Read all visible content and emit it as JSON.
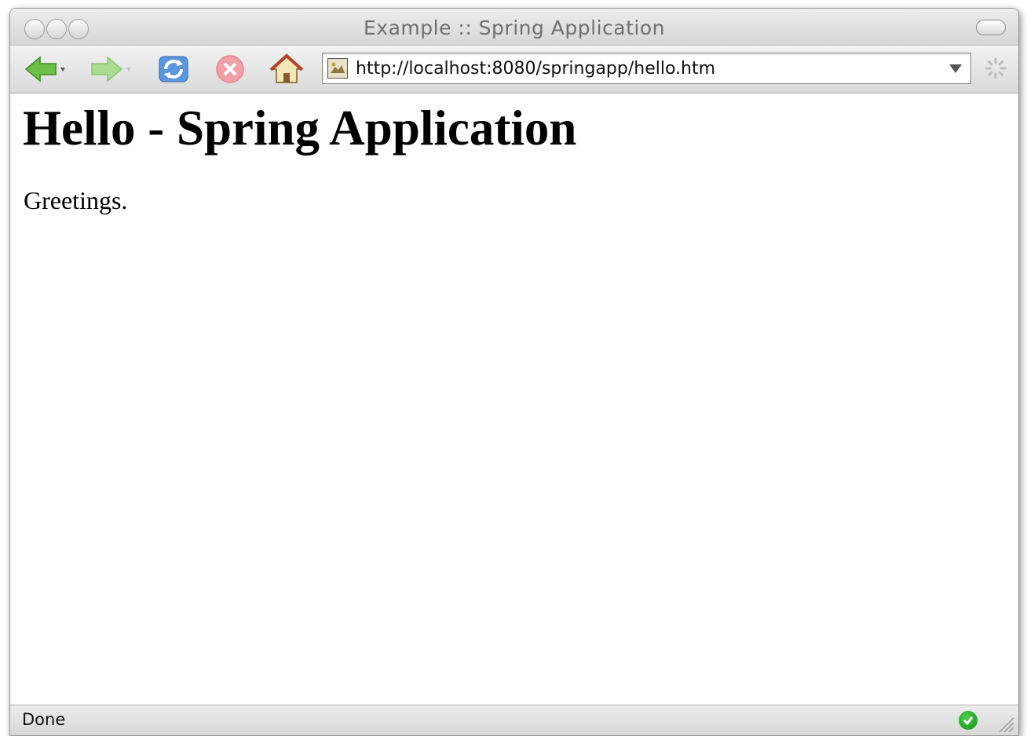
{
  "window": {
    "title": "Example :: Spring Application"
  },
  "toolbar": {
    "back_icon": "back-arrow-icon",
    "forward_icon": "forward-arrow-icon",
    "reload_icon": "reload-icon",
    "stop_icon": "stop-icon",
    "home_icon": "home-icon"
  },
  "address_bar": {
    "url": "http://localhost:8080/springapp/hello.htm"
  },
  "page": {
    "heading": "Hello - Spring Application",
    "body_text": "Greetings."
  },
  "status_bar": {
    "text": "Done"
  },
  "colors": {
    "back_arrow": "#6cc04a",
    "forward_arrow": "#a9dc8f",
    "stop": "#f2a0a8",
    "secure_check": "#1a9a1a"
  }
}
